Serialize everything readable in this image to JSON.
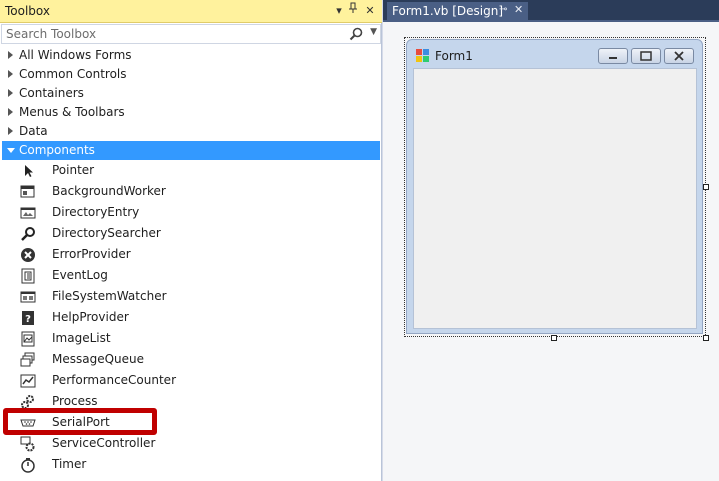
{
  "toolbox": {
    "title": "Toolbox",
    "search_placeholder": "Search Toolbox",
    "categories": [
      {
        "label": "All Windows Forms"
      },
      {
        "label": "Common Controls"
      },
      {
        "label": "Containers"
      },
      {
        "label": "Menus & Toolbars"
      },
      {
        "label": "Data"
      },
      {
        "label": "Components"
      }
    ],
    "selected_category": "Components",
    "items": [
      {
        "label": "Pointer",
        "icon": "pointer-icon"
      },
      {
        "label": "BackgroundWorker",
        "icon": "background-worker-icon"
      },
      {
        "label": "DirectoryEntry",
        "icon": "directory-entry-icon"
      },
      {
        "label": "DirectorySearcher",
        "icon": "directory-searcher-icon"
      },
      {
        "label": "ErrorProvider",
        "icon": "error-provider-icon"
      },
      {
        "label": "EventLog",
        "icon": "event-log-icon"
      },
      {
        "label": "FileSystemWatcher",
        "icon": "file-system-watcher-icon"
      },
      {
        "label": "HelpProvider",
        "icon": "help-provider-icon"
      },
      {
        "label": "ImageList",
        "icon": "image-list-icon"
      },
      {
        "label": "MessageQueue",
        "icon": "message-queue-icon"
      },
      {
        "label": "PerformanceCounter",
        "icon": "performance-counter-icon"
      },
      {
        "label": "Process",
        "icon": "process-icon"
      },
      {
        "label": "SerialPort",
        "icon": "serial-port-icon"
      },
      {
        "label": "ServiceController",
        "icon": "service-controller-icon"
      },
      {
        "label": "Timer",
        "icon": "timer-icon"
      }
    ]
  },
  "designer": {
    "tab_label": "Form1.vb [Design]",
    "form_title": "Form1"
  },
  "colors": {
    "toolbox_header": "#fff29d",
    "selection": "#3399ff",
    "highlight_box": "#c00000",
    "doc_tabstrip": "#2b3c59"
  }
}
